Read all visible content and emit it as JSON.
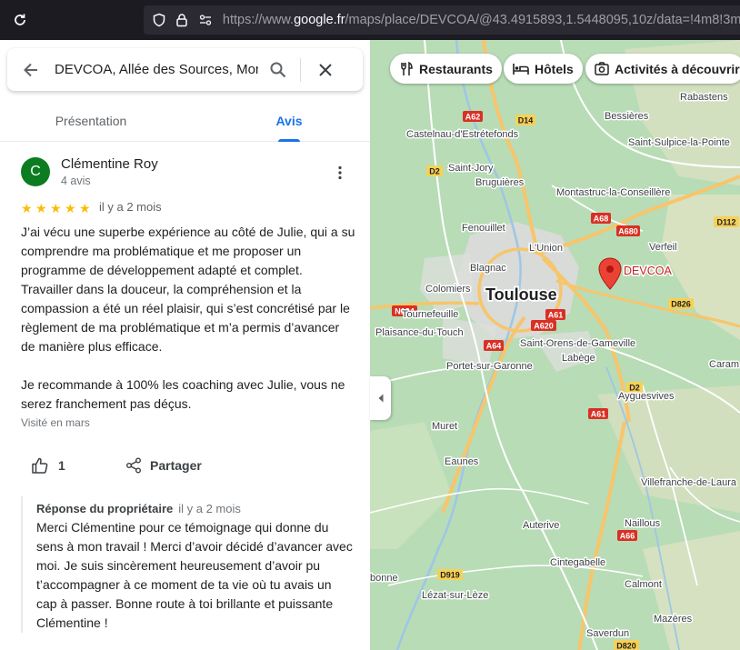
{
  "browser": {
    "url_prefix": "https://www.",
    "url_domain": "google.fr",
    "url_rest": "/maps/place/DEVCOA/@43.4915893,1.5448095,10z/data=!4m8!3m7"
  },
  "search": {
    "value": "DEVCOA, Allée des Sources, Montrabé"
  },
  "tabs": {
    "presentation": "Présentation",
    "avis": "Avis"
  },
  "review": {
    "avatar_letter": "C",
    "name": "Clémentine Roy",
    "meta": "4 avis",
    "rating": 5,
    "stars": [
      "★",
      "★",
      "★",
      "★",
      "★"
    ],
    "date": "il y a 2 mois",
    "text": "J’ai vécu une superbe expérience au côté de Julie, qui a su comprendre ma problématique et me proposer un programme de développement adapté et complet. Travailler dans la douceur, la compréhension et la compassion a été un réel plaisir, qui s’est concrétisé par le règlement de ma problématique et m’a permis d’avancer de manière plus efficace.\n\nJe recommande à 100% les coaching avec Julie, vous ne serez franchement pas déçus.",
    "visited": "Visité en mars",
    "like_count": "1",
    "share_label": "Partager"
  },
  "owner_reply": {
    "title": "Réponse du propriétaire",
    "date": "il y a 2 mois",
    "text": "Merci Clémentine pour ce témoignage qui donne du sens à mon travail ! Merci d’avoir décidé d’avancer avec moi. Je suis sincèrement heureusement d’avoir pu t’accompagner à ce moment de ta vie où tu avais un cap à passer. Bonne route à toi brillante et puissante Clémentine !"
  },
  "chips": {
    "restaurants": "Restaurants",
    "hotels": "Hôtels",
    "activites": "Activités à découvrir"
  },
  "map": {
    "marker_label": "DEVCOA",
    "city_main": "Toulouse",
    "places": {
      "rabastens": "Rabastens",
      "bessieres": "Bessières",
      "castelnau": "Castelnau-d'Estrétefonds",
      "saint_sulpice": "Saint-Sulpice-la-Pointe",
      "saint_jory": "Saint-Jory",
      "bruguieres": "Bruguières",
      "montastruc": "Montastruc-la-Conseillère",
      "fenouillet": "Fenouillet",
      "lunion": "L'Union",
      "verfeil": "Verfeil",
      "blagnac": "Blagnac",
      "colomiers": "Colomiers",
      "tournefeuille": "Tournefeuille",
      "plaisance": "Plaisance-du-Touch",
      "saint_orens": "Saint-Orens-de-Gameville",
      "labege": "Labège",
      "caram": "Caram",
      "portet": "Portet-sur-Garonne",
      "muret": "Muret",
      "ayguesvives": "Ayguesvives",
      "eaunes": "Eaunes",
      "villefranche": "Villefranche-de-Laura",
      "naillous": "Naillous",
      "auterive": "Auterive",
      "cintegabelle": "Cintegabelle",
      "calmont": "Calmont",
      "bonne": "bonne",
      "lezat": "Lézat-sur-Lèze",
      "mazeres": "Mazères",
      "saverdun": "Saverdun"
    },
    "roads": {
      "a62": "A62",
      "d14": "D14",
      "d2": "D2",
      "a68": "A68",
      "a680": "A680",
      "d112": "D112",
      "d826": "D826",
      "n124": "N124",
      "a61": "A61",
      "a620": "A620",
      "a64": "A64",
      "d2b": "D2",
      "a61b": "A61",
      "a66": "A66",
      "d919": "D919",
      "d820": "D820"
    }
  }
}
